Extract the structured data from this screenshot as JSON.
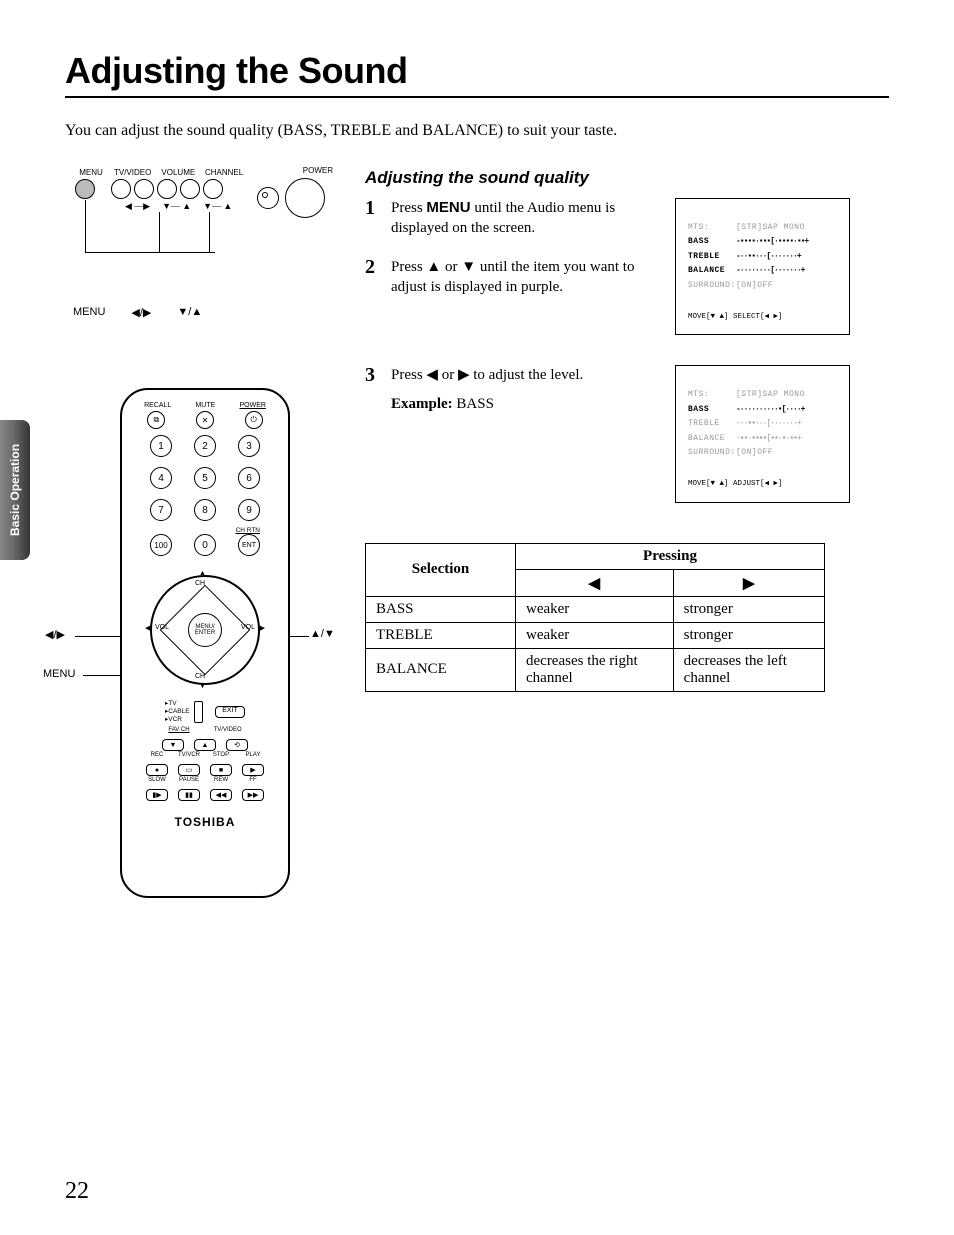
{
  "page_title": "Adjusting the Sound",
  "intro": "You can adjust the sound quality (BASS, TREBLE and BALANCE) to suit your taste.",
  "side_tab": "Basic Operation",
  "tv_panel": {
    "labels": {
      "menu": "MENU",
      "tvvideo": "TV/VIDEO",
      "volume": "VOLUME",
      "channel": "CHANNEL",
      "power": "POWER"
    },
    "arrow_pairs": {
      "lr": "◀ —▶",
      "du": "▼— ▲",
      "du2": "▼— ▲"
    },
    "bottom": {
      "menu": "MENU",
      "lr": "◀/▶",
      "ud": "▼/▲"
    }
  },
  "remote": {
    "top_labels": {
      "recall": "RECALL",
      "mute": "MUTE",
      "power": "POWER"
    },
    "top_underline": "——",
    "icons": {
      "recall": "⧉",
      "mute": "✕",
      "power": "⏻"
    },
    "nums": {
      "n1": "1",
      "n2": "2",
      "n3": "3",
      "n4": "4",
      "n5": "5",
      "n6": "6",
      "n7": "7",
      "n8": "8",
      "n9": "9",
      "n100": "100",
      "n0": "0"
    },
    "chrtn": "CH RTN",
    "ent": "ENT",
    "dpad": {
      "ch_up": "CH",
      "vol_l": "VOL",
      "center1": "MENU/",
      "center2": "ENTER",
      "vol_r": "VOL",
      "ch_dn": "CH",
      "arrows": {
        "u": "▲",
        "d": "▼",
        "l": "◀",
        "r": "▶"
      }
    },
    "switch": {
      "tv": "TV",
      "cable": "CABLE",
      "vcr": "VCR",
      "exit": "EXIT"
    },
    "row1_lbls": {
      "favch": "FAV CH",
      "tvvideo": "TV/VIDEO"
    },
    "row1_btns": {
      "a": "▼",
      "b": "▲",
      "c": "⟲"
    },
    "row2_lbls": {
      "rec": "REC",
      "tvvcr": "TV/VCR",
      "stop": "STOP",
      "play": "PLAY"
    },
    "row2_btns": {
      "a": "●",
      "b": "▭",
      "c": "■",
      "d": "▶"
    },
    "row3_lbls": {
      "slow": "SLOW",
      "pause": "PAUSE",
      "rew": "REW",
      "ff": "FF"
    },
    "row3_btns": {
      "a": "▮▶",
      "b": "▮▮",
      "c": "◀◀",
      "d": "▶▶"
    },
    "brand": "TOSHIBA",
    "side": {
      "lr": "◀/▶",
      "menu": "MENU",
      "ud": "▲/▼"
    }
  },
  "section": {
    "subheading": "Adjusting the sound quality",
    "step1_num": "1",
    "step1_a": "Press ",
    "step1_menu": "MENU",
    "step1_b": " until the Audio menu is displayed on the screen.",
    "step2_num": "2",
    "step2_a": "Press ",
    "step2_up": "▲",
    "step2_mid": " or ",
    "step2_dn": "▼",
    "step2_b": " until the item you want to adjust is displayed in purple.",
    "step3_num": "3",
    "step3_a": "Press ",
    "step3_l": "◀",
    "step3_mid": " or ",
    "step3_r": "▶",
    "step3_b": " to adjust the level.",
    "example_lbl": "Example:",
    "example_val": " BASS"
  },
  "osd1": {
    "mts_k": "MTS:",
    "mts_v": "[STR]SAP MONO",
    "bass_k": "BASS",
    "bass_v": "-▪▪▪▪·▪▪▪[·▪▪▪▪·▪▪+",
    "treble_k": "TREBLE",
    "treble_v": "-··▪▪···[·······+",
    "balance_k": "BALANCE",
    "balance_v": "-········[·······+",
    "surround_k": "SURROUND:",
    "surround_v": "[ON]OFF",
    "foot": "MOVE[▼ ▲]  SELECT[◀ ▶]"
  },
  "osd2": {
    "mts_k": "MTS:",
    "mts_v": "[STR]SAP MONO",
    "bass_k": "BASS",
    "bass_v": "-··········▪[····+",
    "treble_k": "TREBLE",
    "treble_v": "-··▪▪···[·······+",
    "balance_k": "BALANCE",
    "balance_v": "-▪▪·▪▪▪▪[▪▪·▪·▪▪+",
    "surround_k": "SURROUND:",
    "surround_v": "[ON]OFF",
    "foot": "MOVE[▼ ▲]  ADJUST[◀ ▶]"
  },
  "table": {
    "selection": "Selection",
    "pressing": "Pressing",
    "left_arrow": "◀",
    "right_arrow": "▶",
    "rows": [
      {
        "sel": "BASS",
        "l": "weaker",
        "r": "stronger"
      },
      {
        "sel": "TREBLE",
        "l": "weaker",
        "r": "stronger"
      },
      {
        "sel": "BALANCE",
        "l": "decreases the right channel",
        "r": "decreases the left channel"
      }
    ]
  },
  "page_number": "22"
}
